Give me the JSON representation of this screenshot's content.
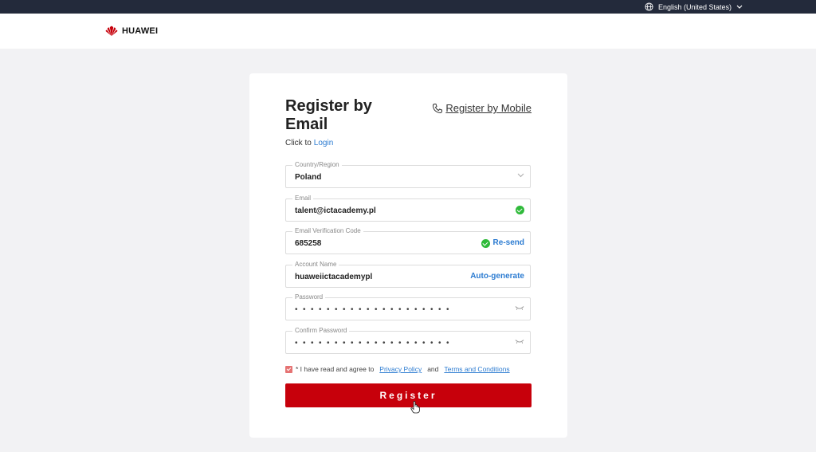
{
  "topbar": {
    "language": "English (United States)"
  },
  "header": {
    "brand": "HUAWEI"
  },
  "form": {
    "title": "Register by Email",
    "switch_link": "Register by Mobile",
    "login_prefix": "Click to",
    "login_link": "Login",
    "fields": {
      "country": {
        "label": "Country/Region",
        "value": "Poland"
      },
      "email": {
        "label": "Email",
        "value": "talent@ictacademy.pl"
      },
      "code": {
        "label": "Email Verification Code",
        "value": "685258",
        "action": "Re-send"
      },
      "account": {
        "label": "Account Name",
        "value": "huaweiictacademypl",
        "action": "Auto-generate"
      },
      "password": {
        "label": "Password",
        "value": "••••••••••••••••••••"
      },
      "confirm": {
        "label": "Confirm Password",
        "value": "••••••••••••••••••••"
      }
    },
    "agreement": {
      "prefix": "* I have read and agree to",
      "privacy": "Privacy Policy",
      "and": "and",
      "terms": "Terms and Conditions"
    },
    "submit_label": "Register"
  },
  "colors": {
    "brand_red": "#c7000b",
    "link_blue": "#2b7bd1",
    "success_green": "#2fba3a",
    "topbar": "#232a3b"
  },
  "icons": [
    "globe-icon",
    "chevron-down-icon",
    "huawei-logo-icon",
    "phone-icon",
    "check-circle-icon",
    "eye-closed-icon",
    "checkbox-checked-icon",
    "hand-cursor-icon"
  ]
}
